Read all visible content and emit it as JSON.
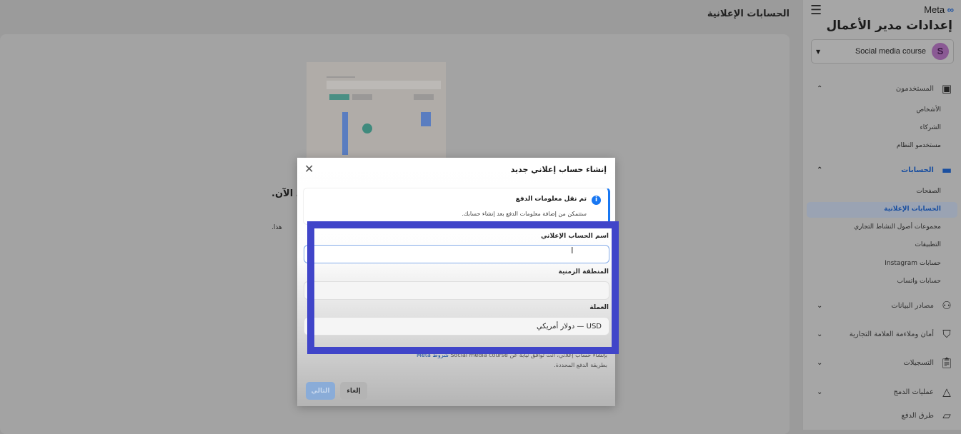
{
  "main": {
    "title": "الحسابات الإعلانية",
    "partial_heading": "ي الآن.",
    "partial_text": "هذا."
  },
  "sidebar": {
    "brand": "Meta",
    "title": "إعدادات مدير الأعمال",
    "business": {
      "name": "Social media course",
      "avatar_letter": "S"
    },
    "sections": [
      {
        "label": "المستخدمون",
        "icon": "users-icon",
        "expanded": true,
        "items": [
          "الأشخاص",
          "الشركاء",
          "مستخدمو النظام"
        ]
      },
      {
        "label": "الحسابات",
        "icon": "accounts-icon",
        "expanded": true,
        "active": true,
        "items": [
          "الصفحات",
          "الحسابات الإعلانية",
          "مجموعات أصول النشاط التجاري",
          "التطبيقات",
          "حسابات Instagram",
          "حسابات واتساب"
        ]
      },
      {
        "label": "مصادر البيانات",
        "icon": "data-sources-icon",
        "expanded": false
      },
      {
        "label": "أمان وملاءمة العلامة التجارية",
        "icon": "shield-icon",
        "expanded": false
      },
      {
        "label": "التسجيلات",
        "icon": "clipboard-icon",
        "expanded": false
      },
      {
        "label": "عمليات الدمج",
        "icon": "integrations-icon",
        "expanded": false
      },
      {
        "label": "طرق الدفع",
        "icon": "credit-card-icon"
      }
    ],
    "selected_item": "الحسابات الإعلانية",
    "accent": "#1877f2"
  },
  "dialog": {
    "title": "إنشاء حساب إعلاني جديد",
    "notice": {
      "title": "تم نقل معلومات الدفع",
      "body": "ستتمكن من إضافة معلومات الدفع بعد إنشاء حسابك."
    },
    "fields": {
      "name": {
        "label": "اسم الحساب الإعلاني",
        "value": "",
        "placeholder": ""
      },
      "timezone": {
        "label": "المنطقة الزمنية",
        "value": ""
      },
      "currency": {
        "label": "العملة",
        "value": "USD — دولار أمريكي"
      }
    },
    "terms": {
      "line1_a": "بإنشاء حساب إعلاني، أنت توافق نيابة عن",
      "business": "Social media course",
      "link": "شروط Meta",
      "line2": "بطريقة الدفع المحددة."
    },
    "buttons": {
      "cancel": "إلغاء",
      "next": "التالي"
    }
  },
  "highlight_color": "#4045c9"
}
